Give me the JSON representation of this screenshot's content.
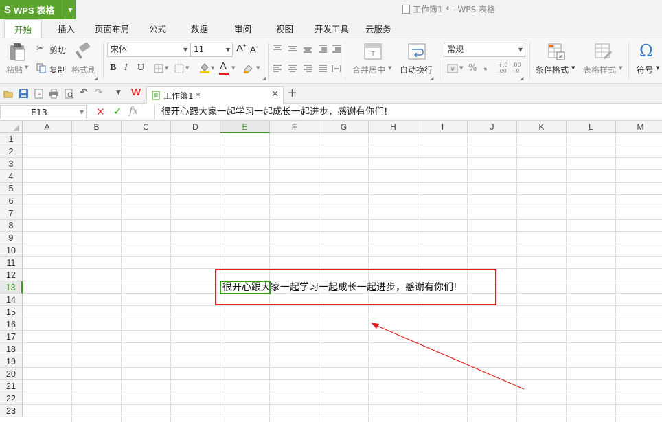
{
  "app": {
    "logo": "S",
    "name": "WPS 表格",
    "window_title": "工作簿1 * - WPS 表格"
  },
  "menu": {
    "tabs": [
      "开始",
      "插入",
      "页面布局",
      "公式",
      "数据",
      "审阅",
      "视图",
      "开发工具",
      "云服务"
    ],
    "active": "开始"
  },
  "ribbon": {
    "paste": "粘贴",
    "cut": "剪切",
    "copy": "复制",
    "format_painter": "格式刷",
    "font_name": "宋体",
    "font_size": "11",
    "bold": "B",
    "italic": "I",
    "underline": "U",
    "merge_center": "合并居中",
    "wrap_text": "自动换行",
    "number_format": "常规",
    "percent": "%",
    "comma": "❟",
    "conditional_format": "条件格式",
    "table_style": "表格样式",
    "symbol": "符号"
  },
  "doc_tab": {
    "label": "工作簿1 *"
  },
  "formula_bar": {
    "name_box": "E13",
    "fx": "fx",
    "content": "很开心跟大家一起学习一起成长一起进步，感谢有你们!"
  },
  "sheet": {
    "columns": [
      "A",
      "B",
      "C",
      "D",
      "E",
      "F",
      "G",
      "H",
      "I",
      "J",
      "K",
      "L",
      "M"
    ],
    "rows": [
      "1",
      "2",
      "3",
      "4",
      "5",
      "6",
      "7",
      "8",
      "9",
      "10",
      "11",
      "12",
      "13",
      "14",
      "15",
      "16",
      "17",
      "18",
      "19",
      "20",
      "21",
      "22",
      "23"
    ],
    "selected_column": "E",
    "selected_row": "13",
    "active_cell_value": "很开心跟大家一起学习一起成长一起进步，感谢有你们!"
  },
  "colors": {
    "accent": "#3a9a1a",
    "brand": "#5aa32c",
    "annotation": "#e02020"
  }
}
